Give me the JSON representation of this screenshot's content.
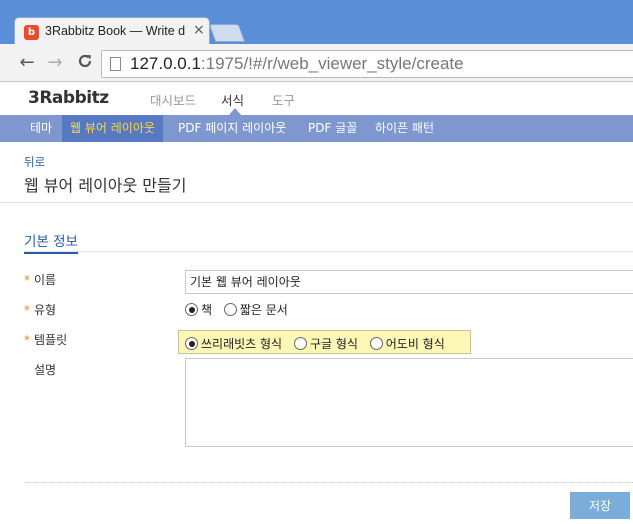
{
  "browser": {
    "tab_title": "3Rabbitz Book — Write d",
    "favicon_letter": "b",
    "close_glyph": "×",
    "nav": {
      "back": "←",
      "forward": "→",
      "reload": "C"
    },
    "url_host": "127.0.0.1",
    "url_rest": ":1975/!#/r/web_viewer_style/create"
  },
  "header": {
    "logo_num": "3",
    "logo_text": "Rabbitz",
    "nav": [
      "대시보드",
      "서식",
      "도구"
    ],
    "active_nav": "서식"
  },
  "subnav": {
    "items": [
      "테마",
      "웹 뷰어 레이아웃",
      "PDF 페이지 레이아웃",
      "PDF 글꼴",
      "하이픈 패턴"
    ],
    "active": "웹 뷰어 레이아웃"
  },
  "content": {
    "back": "뒤로",
    "title": "웹 뷰어 레이아웃 만들기",
    "section": "기본 정보",
    "required_mark": "*",
    "fields": {
      "name_label": "이름",
      "name_value": "기본 웹 뷰어 레이아웃",
      "type_label": "유형",
      "type_options": [
        "책",
        "짧은 문서"
      ],
      "type_selected": "책",
      "template_label": "템플릿",
      "template_options": [
        "쓰리래빗츠 형식",
        "구글 형식",
        "어도비 형식"
      ],
      "template_selected": "쓰리래빗츠 형식",
      "desc_label": "설명"
    },
    "save": "저장"
  },
  "colors": {
    "titlebar": "#5a8fd8",
    "subnav": "#7e98cf",
    "subnav_active": "#5779c2",
    "subnav_active_text": "#ffd93d",
    "link": "#2a5aa8",
    "required": "#e08a1e",
    "template_highlight": "#fdf7b6",
    "save_button": "#7aaed9"
  }
}
